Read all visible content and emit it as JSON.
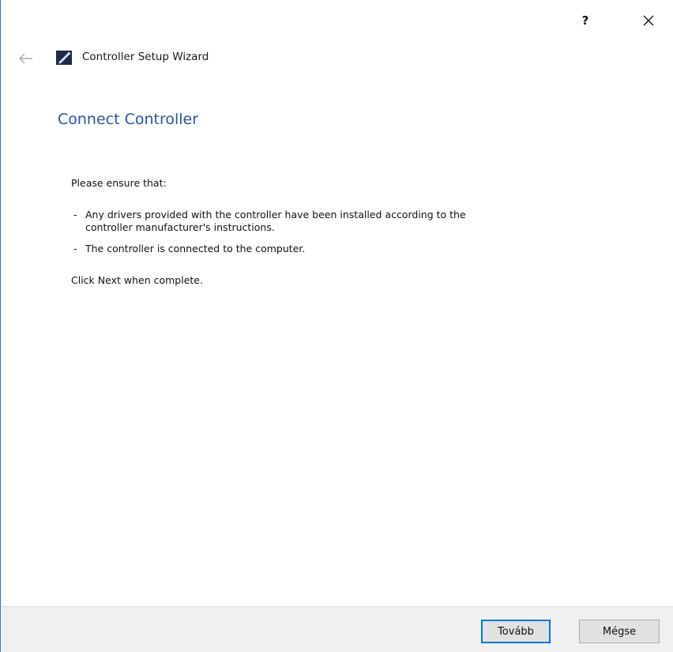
{
  "window": {
    "title": "Controller Setup Wizard",
    "help_label": "?",
    "accent_color": "#2b73d6"
  },
  "icons": {
    "close": "close-icon",
    "help": "help-icon",
    "back": "back-arrow-icon",
    "app": "wizard-quill-icon"
  },
  "page": {
    "title": "Connect Controller",
    "title_color": "#2a55a6",
    "intro": "Please ensure that:",
    "bullets": [
      {
        "dash": "-",
        "line1": "Any drivers provided with the controller have been installed according to the",
        "line2": "controller manufacturer's instructions."
      },
      {
        "dash": "-",
        "line1": "The controller is connected to the computer."
      }
    ],
    "closing": "Click Next when complete."
  },
  "buttons": {
    "next_label": "Tovább",
    "cancel_label": "Mégse"
  }
}
